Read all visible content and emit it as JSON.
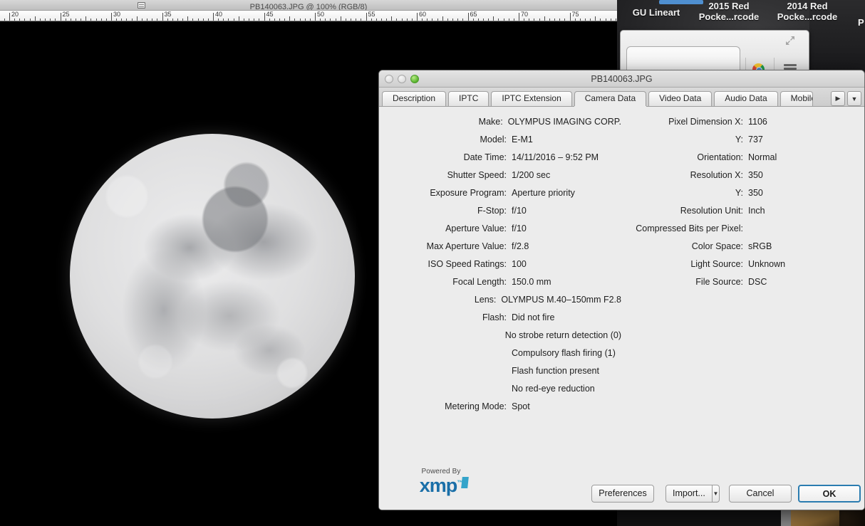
{
  "desktop": {
    "thumbnails": [
      {
        "label": "GU Lineart",
        "selected": true
      },
      {
        "label": "2015 Red\nPocke...rcode",
        "selected": false
      },
      {
        "label": "2014 Red\nPocke...rcode",
        "selected": false
      }
    ],
    "partial_label": "P"
  },
  "photoshop": {
    "title": "PB140063.JPG @ 100% (RGB/8)",
    "ruler": {
      "labels": [
        "20",
        "25",
        "30",
        "35",
        "40",
        "45",
        "50",
        "55",
        "60",
        "65",
        "70",
        "75"
      ],
      "unit": "cm"
    }
  },
  "dialog": {
    "title": "PB140063.JPG",
    "traffic_lights": [
      "close",
      "minimize",
      "zoom"
    ],
    "tabs": [
      {
        "label": "Description",
        "active": false
      },
      {
        "label": "IPTC",
        "active": false
      },
      {
        "label": "IPTC Extension",
        "active": false
      },
      {
        "label": "Camera Data",
        "active": true
      },
      {
        "label": "Video Data",
        "active": false
      },
      {
        "label": "Audio Data",
        "active": false
      },
      {
        "label": "Mobile",
        "active": false
      }
    ],
    "tab_nav": {
      "next": "▶",
      "list": "▼"
    },
    "left_fields": [
      {
        "label": "Make:",
        "value": "OLYMPUS IMAGING CORP."
      },
      {
        "label": "Model:",
        "value": "E-M1"
      },
      {
        "label": "Date Time:",
        "value": "14/11/2016 – 9:52 PM"
      },
      {
        "label": "Shutter Speed:",
        "value": "1/200 sec"
      },
      {
        "label": "Exposure Program:",
        "value": "Aperture priority"
      },
      {
        "label": "F-Stop:",
        "value": "f/10"
      },
      {
        "label": "Aperture Value:",
        "value": "f/10"
      },
      {
        "label": "Max Aperture Value:",
        "value": "f/2.8"
      },
      {
        "label": "ISO Speed Ratings:",
        "value": "100"
      },
      {
        "label": "Focal Length:",
        "value": "150.0 mm"
      },
      {
        "label": "Lens:",
        "value": "OLYMPUS M.40–150mm F2.8"
      },
      {
        "label": "Flash:",
        "value": "Did not fire"
      },
      {
        "label": "",
        "value": "No strobe return detection (0)"
      },
      {
        "label": "",
        "value": "Compulsory flash firing (1)"
      },
      {
        "label": "",
        "value": "Flash function present"
      },
      {
        "label": "",
        "value": "No red-eye reduction"
      },
      {
        "label": "Metering Mode:",
        "value": "Spot"
      }
    ],
    "right_fields": [
      {
        "label": "Pixel Dimension X:",
        "value": "1106"
      },
      {
        "label": "Y:",
        "value": "737"
      },
      {
        "label": "Orientation:",
        "value": "Normal"
      },
      {
        "label": "Resolution X:",
        "value": "350"
      },
      {
        "label": "Y:",
        "value": "350"
      },
      {
        "label": "Resolution Unit:",
        "value": "Inch"
      },
      {
        "label": "Compressed Bits per Pixel:",
        "value": ""
      },
      {
        "label": "Color Space:",
        "value": "sRGB"
      },
      {
        "label": "Light Source:",
        "value": "Unknown"
      },
      {
        "label": "File Source:",
        "value": "DSC"
      }
    ],
    "xmp": {
      "powered_by": "Powered By",
      "wordmark": "xmp",
      "tm": "™"
    },
    "buttons": {
      "preferences": "Preferences",
      "import": "Import...",
      "import_arrow": "▼",
      "cancel": "Cancel",
      "ok": "OK"
    }
  },
  "colors": {
    "dialog_bg": "#ececec",
    "default_button_border": "#2b7cb0",
    "xmp_blue": "#1a6fa8",
    "xmp_cyan": "#2aa0c8",
    "selection_blue": "#4f8fd0"
  }
}
